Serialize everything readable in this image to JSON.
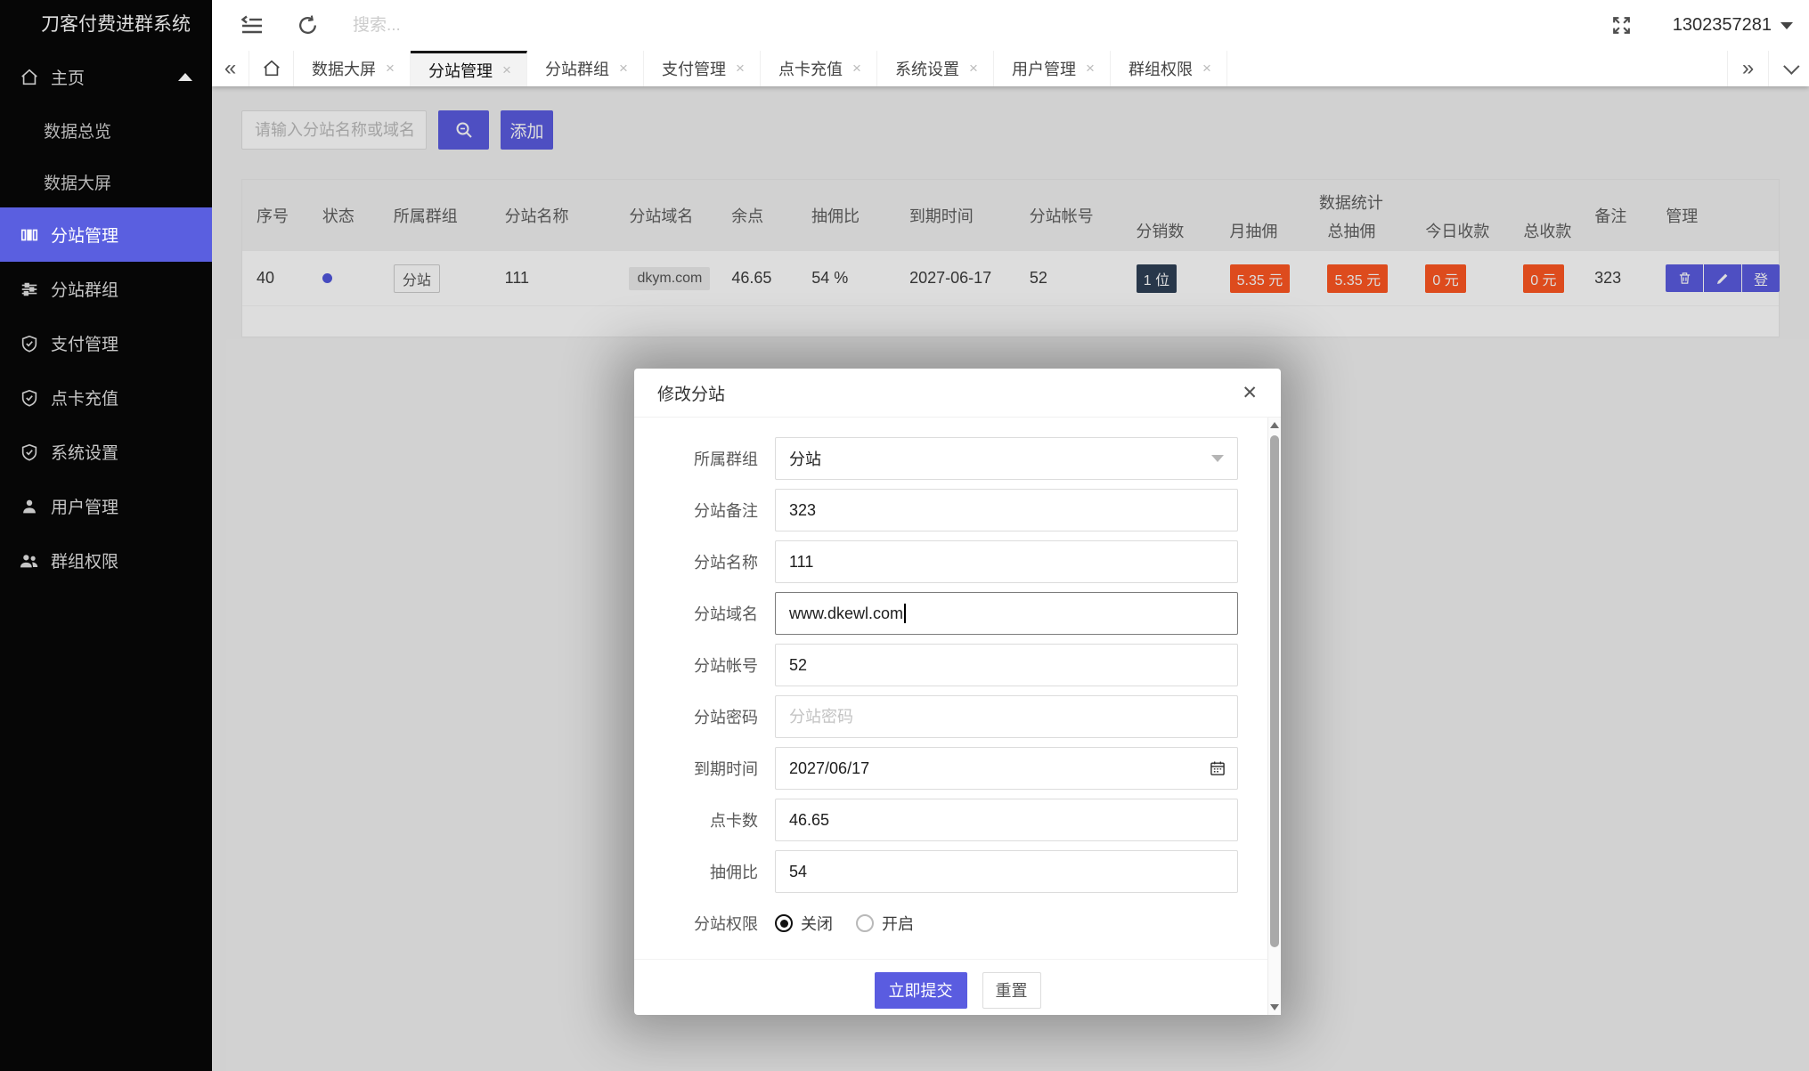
{
  "app": {
    "title": "刀客付费进群系统"
  },
  "topbar": {
    "search_placeholder": "搜索...",
    "user_id": "1302357281"
  },
  "sidebar": {
    "home": {
      "label": "主页",
      "children": [
        {
          "label": "数据总览"
        },
        {
          "label": "数据大屏"
        }
      ]
    },
    "items": [
      {
        "label": "分站管理",
        "active": true
      },
      {
        "label": "分站群组"
      },
      {
        "label": "支付管理"
      },
      {
        "label": "点卡充值"
      },
      {
        "label": "系统设置"
      },
      {
        "label": "用户管理"
      },
      {
        "label": "群组权限"
      }
    ]
  },
  "tabbar": {
    "scroll_left_glyph": "«",
    "scroll_right_glyph": "»",
    "close_glyph": "×",
    "tabs": [
      {
        "label": "数据大屏"
      },
      {
        "label": "分站管理",
        "active": true
      },
      {
        "label": "分站群组"
      },
      {
        "label": "支付管理"
      },
      {
        "label": "点卡充值"
      },
      {
        "label": "系统设置"
      },
      {
        "label": "用户管理"
      },
      {
        "label": "群组权限"
      }
    ]
  },
  "toolbar": {
    "search_placeholder": "请输入分站名称或域名",
    "add_label": "添加"
  },
  "table": {
    "columns": [
      "序号",
      "状态",
      "所属群组",
      "分站名称",
      "分站域名",
      "余点",
      "抽佣比",
      "到期时间",
      "分站帐号"
    ],
    "stats_group_label": "数据统计",
    "stats_columns": [
      "分销数",
      "月抽佣",
      "总抽佣",
      "今日收款",
      "总收款"
    ],
    "tail_columns": [
      "备注",
      "管理"
    ],
    "row": {
      "seq": "40",
      "group_tag": "分站",
      "name": "111",
      "domain": "dkym.com",
      "balance": "46.65",
      "rate": "54 %",
      "expire": "2027-06-17",
      "account": "52",
      "distributors": "1 位",
      "month_commission": "5.35 元",
      "total_commission": "5.35 元",
      "today_income": "0 元",
      "total_income": "0 元",
      "remark": "323",
      "login_label": "登"
    }
  },
  "modal": {
    "title": "修改分站",
    "close_glyph": "✕",
    "group": {
      "label": "所属群组",
      "value": "分站"
    },
    "remark": {
      "label": "分站备注",
      "value": "323"
    },
    "name": {
      "label": "分站名称",
      "value": "111"
    },
    "domain": {
      "label": "分站域名",
      "value": "www.dkewl.com"
    },
    "account": {
      "label": "分站帐号",
      "value": "52"
    },
    "password": {
      "label": "分站密码",
      "placeholder": "分站密码"
    },
    "expire": {
      "label": "到期时间",
      "value": "2027/06/17"
    },
    "points": {
      "label": "点卡数",
      "value": "46.65"
    },
    "rate": {
      "label": "抽佣比",
      "value": "54"
    },
    "perm": {
      "label": "分站权限",
      "options": [
        "关闭",
        "开启"
      ],
      "selected": "关闭"
    },
    "submit_label": "立即提交",
    "reset_label": "重置"
  },
  "colors": {
    "accent": "#5a5ce0",
    "sidebar_active": "#5a5fe0",
    "badge_dark": "#2f4056",
    "badge_red": "#ff5722",
    "status_dot": "#5056dd"
  }
}
